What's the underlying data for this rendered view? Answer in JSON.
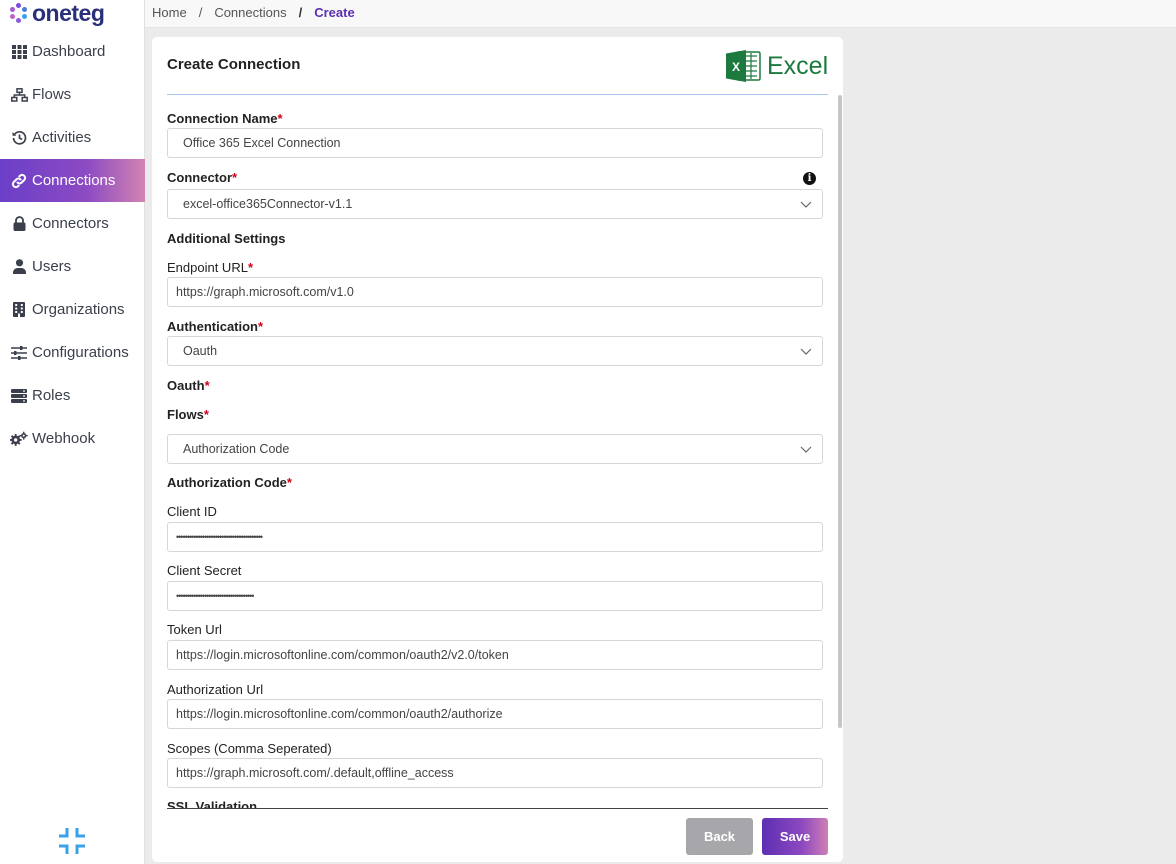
{
  "brand": {
    "name": "oneteg"
  },
  "sidebar": {
    "items": [
      {
        "label": "Dashboard",
        "icon": "grid-icon"
      },
      {
        "label": "Flows",
        "icon": "sitemap-icon"
      },
      {
        "label": "Activities",
        "icon": "history-icon"
      },
      {
        "label": "Connections",
        "icon": "link-icon",
        "active": true
      },
      {
        "label": "Connectors",
        "icon": "lock-icon"
      },
      {
        "label": "Users",
        "icon": "user-icon"
      },
      {
        "label": "Organizations",
        "icon": "building-icon"
      },
      {
        "label": "Configurations",
        "icon": "sliders-icon"
      },
      {
        "label": "Roles",
        "icon": "server-icon"
      },
      {
        "label": "Webhook",
        "icon": "gears-icon"
      }
    ],
    "collapse_icon": "compress-icon"
  },
  "breadcrumb": {
    "home": "Home",
    "sep": "/",
    "section": "Connections",
    "current": "Create"
  },
  "form": {
    "title": "Create Connection",
    "connector_logo": "Excel",
    "connection_name": {
      "label": "Connection Name",
      "value": "Office 365 Excel Connection"
    },
    "connector": {
      "label": "Connector",
      "value": "excel-office365Connector-v1.1"
    },
    "additional_settings": "Additional Settings",
    "endpoint_url": {
      "label": "Endpoint URL",
      "value": "https://graph.microsoft.com/v1.0"
    },
    "authentication": {
      "label": "Authentication",
      "value": "Oauth"
    },
    "oauth_heading": "Oauth",
    "flows": {
      "label": "Flows",
      "value": "Authorization Code"
    },
    "authorization_code_heading": "Authorization Code",
    "client_id": {
      "label": "Client ID",
      "value": "••••••••••••••••••••••••••••••••••••••••"
    },
    "client_secret": {
      "label": "Client Secret",
      "value": "••••••••••••••••••••••••••••••••••••"
    },
    "token_url": {
      "label": "Token Url",
      "value": "https://login.microsoftonline.com/common/oauth2/v2.0/token"
    },
    "authorization_url": {
      "label": "Authorization Url",
      "value": "https://login.microsoftonline.com/common/oauth2/authorize"
    },
    "scopes": {
      "label": "Scopes (Comma Seperated)",
      "value": "https://graph.microsoft.com/.default,offline_access"
    },
    "ssl_validation": {
      "label": "SSL Validation"
    },
    "required_mark": "*",
    "back_label": "Back",
    "save_label": "Save"
  },
  "colors": {
    "accent": "#5b2fb0",
    "excel_green": "#1d7a3e",
    "required": "#d0021b"
  }
}
